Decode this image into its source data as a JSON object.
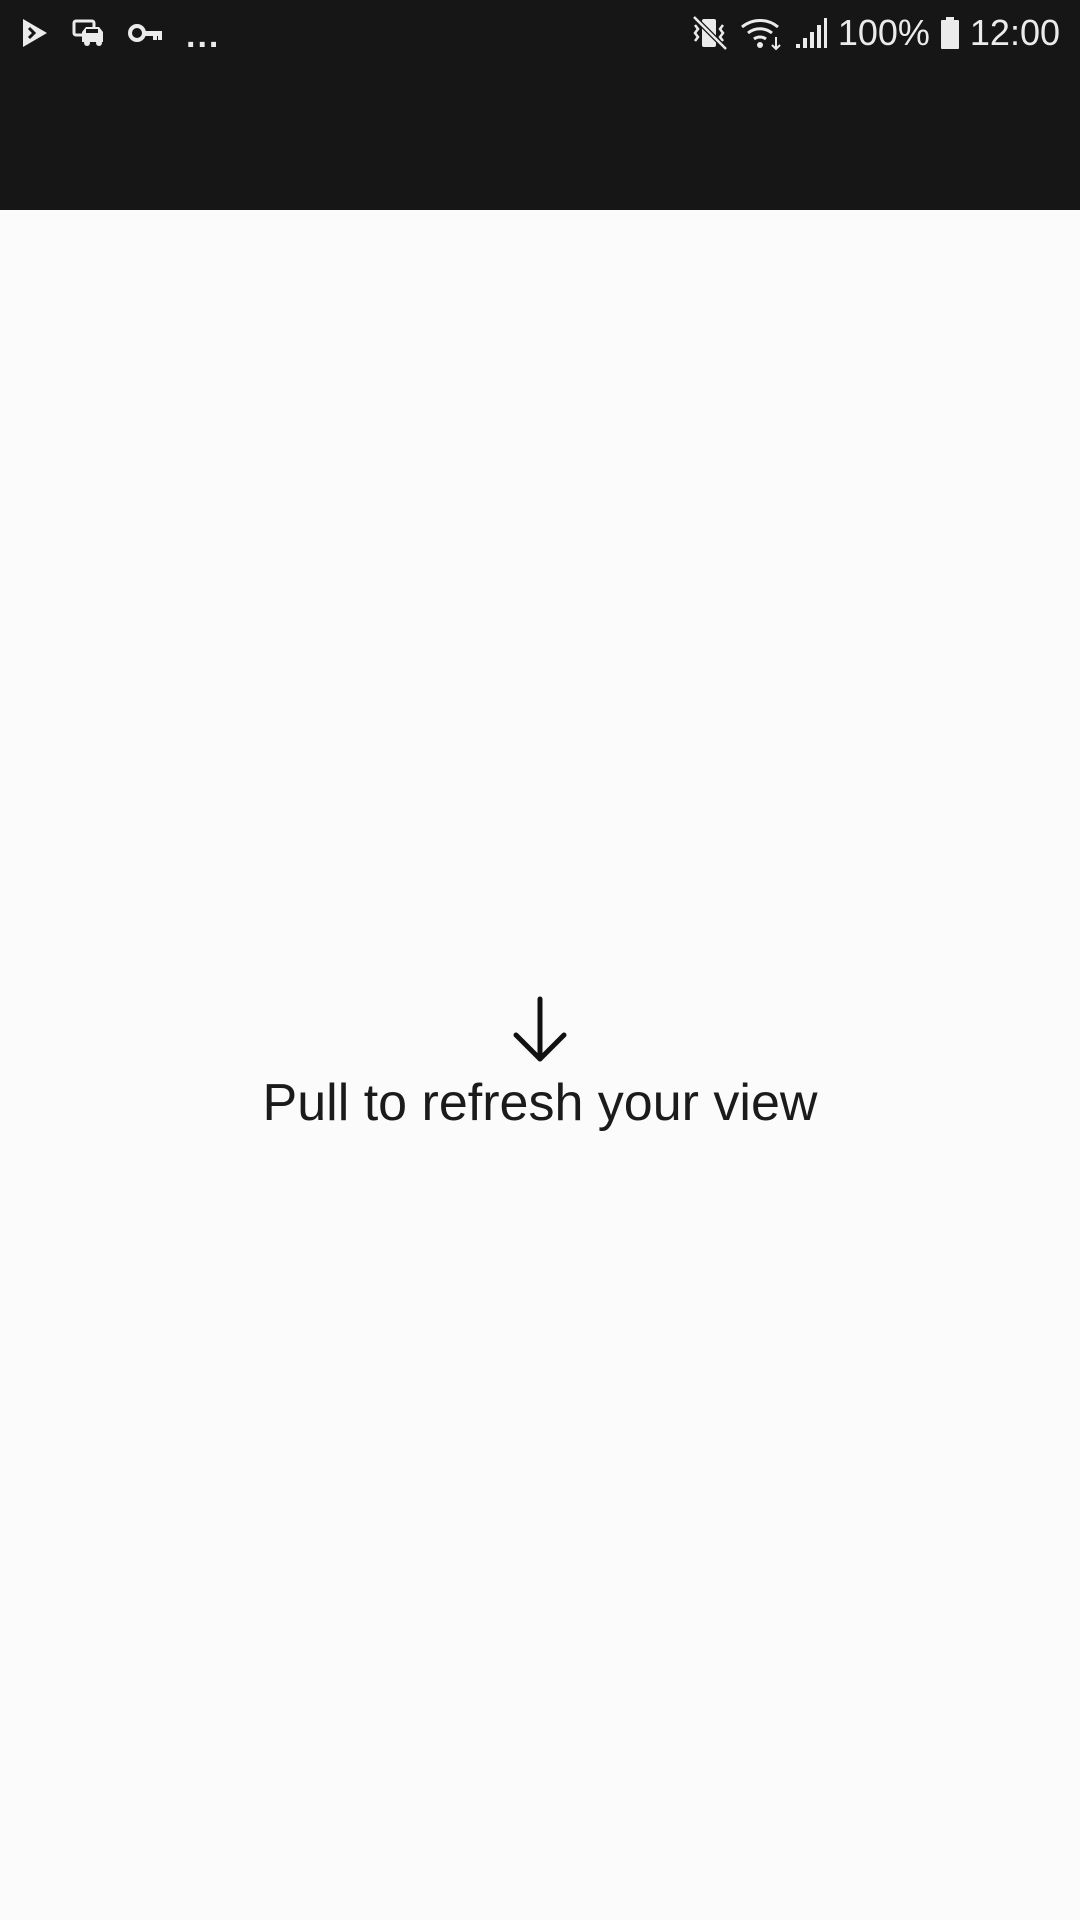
{
  "status_bar": {
    "left_icons": [
      "play-store-icon",
      "car-sync-icon",
      "vpn-key-icon"
    ],
    "more_indicator": "...",
    "right_icons": [
      "vibrate-mute-icon",
      "wifi-icon",
      "cell-signal-icon",
      "battery-icon"
    ],
    "battery_percent": "100%",
    "time": "12:00"
  },
  "main": {
    "hint_icon": "arrow-down-icon",
    "hint_text": "Pull to refresh your view"
  },
  "colors": {
    "status_bar_bg": "#161616",
    "status_icons": "#ebebeb",
    "content_bg": "#fbfbfb",
    "text": "#1b1b1b"
  }
}
